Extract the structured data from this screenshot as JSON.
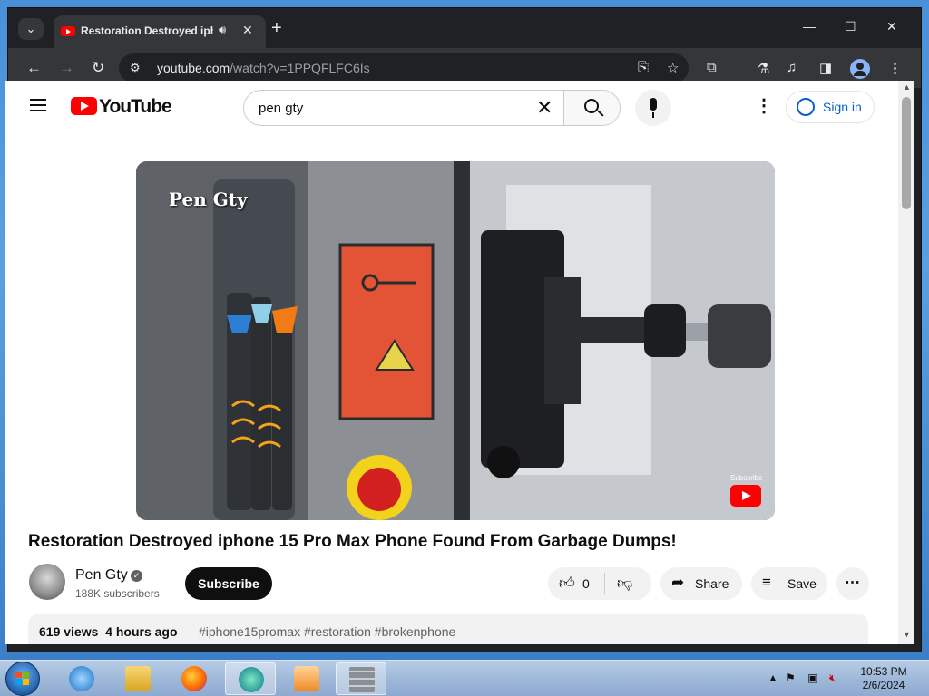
{
  "browser": {
    "tab": {
      "title": "Restoration Destroyed iphone 15 Pro Max Phone Found From Garbage Dumps!"
    },
    "url": {
      "host": "youtube.com",
      "path": "/watch?v=1PPQFLFC6Is"
    }
  },
  "youtube": {
    "logo_text": "YouTube",
    "search": {
      "value": "pen gty",
      "placeholder": "Search"
    },
    "sign_in_label": "Sign in",
    "video": {
      "watermark": "Pen Gty",
      "subscribe_watermark": "Subscribe",
      "title": "Restoration Destroyed iphone 15 Pro Max Phone Found From Garbage Dumps!"
    },
    "channel": {
      "name": "Pen Gty",
      "verified_glyph": "✓",
      "subscribers": "188K subscribers"
    },
    "subscribe_label": "Subscribe",
    "actions": {
      "likes": "0",
      "share": "Share",
      "save": "Save"
    },
    "description": {
      "views": "619 views",
      "posted": "4 hours ago",
      "hashtags": "#iphone15promax #restoration #brokenphone"
    }
  },
  "taskbar": {
    "apps": [
      "ie-icon",
      "explorer-icon",
      "firefox-icon",
      "edge-icon",
      "media-player-icon",
      "firewall-icon"
    ],
    "clock": {
      "time": "10:53 PM",
      "date": "2/6/2024"
    }
  },
  "colors": {
    "youtube_red": "#ff0000",
    "link_blue": "#065fd4",
    "chrome_dark": "#202124"
  }
}
